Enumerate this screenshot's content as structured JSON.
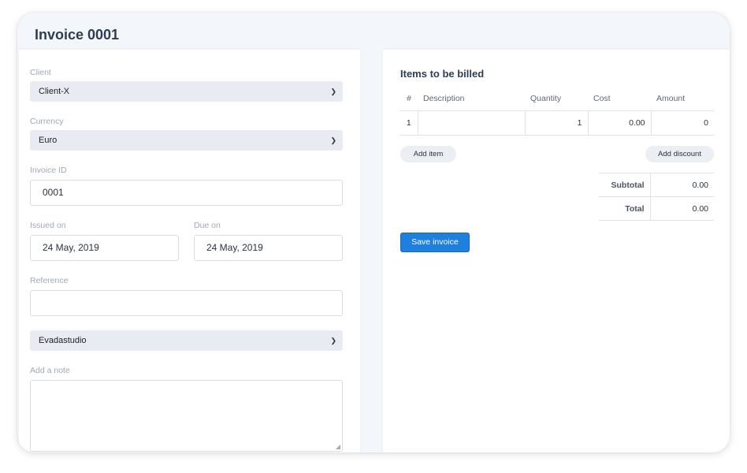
{
  "title": "Invoice 0001",
  "form": {
    "client": {
      "label": "Client",
      "value": "Client-X"
    },
    "currency": {
      "label": "Currency",
      "value": "Euro"
    },
    "invoice_id": {
      "label": "Invoice ID",
      "value": "0001"
    },
    "issued_on": {
      "label": "Issued on",
      "value": "24 May, 2019"
    },
    "due_on": {
      "label": "Due on",
      "value": "24 May, 2019"
    },
    "reference": {
      "label": "Reference",
      "value": ""
    },
    "company": {
      "value": "Evadastudio"
    },
    "note": {
      "label": "Add a note",
      "value": ""
    }
  },
  "items": {
    "title": "Items to be billed",
    "columns": [
      "#",
      "Description",
      "Quantity",
      "Cost",
      "Amount"
    ],
    "rows": [
      {
        "index": "1",
        "description": "",
        "quantity": "1",
        "cost": "0.00",
        "amount": "0"
      }
    ],
    "add_item_label": "Add item",
    "add_discount_label": "Add discount"
  },
  "totals": {
    "subtotal_label": "Subtotal",
    "subtotal_value": "0.00",
    "total_label": "Total",
    "total_value": "0.00"
  },
  "save_label": "Save invoice",
  "icons": {
    "select_chevron": "chevron-down-icon",
    "resize_grip": "resize-grip-icon"
  },
  "colors": {
    "accent": "#1e7fdd",
    "background": "#f3f6fa",
    "field": "#e8ecf2"
  }
}
